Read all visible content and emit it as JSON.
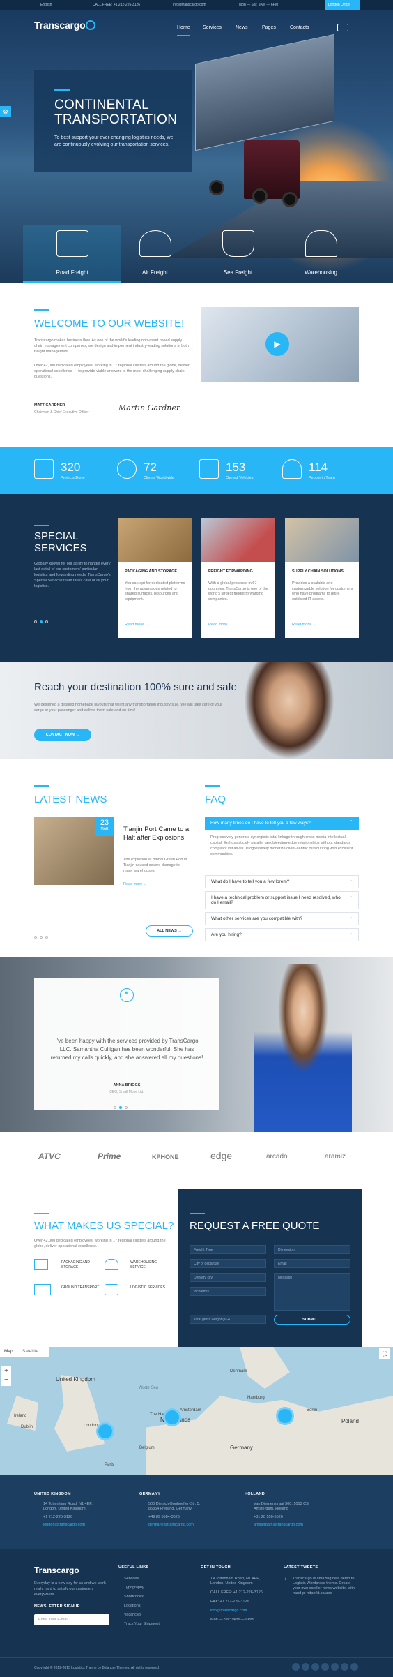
{
  "topbar": {
    "lang": "English",
    "phone": "CALL FREE: +1 212-226-3126",
    "email": "info@transcargo.com",
    "hours": "Mon — Sat: 9AM — 6PM",
    "office": "London Office"
  },
  "brand": {
    "name": "Transcargo"
  },
  "nav": [
    "Home",
    "Services",
    "News",
    "Pages",
    "Contacts"
  ],
  "hero": {
    "title_1": "CONTINENTAL",
    "title_2": "TRANSPORTATION",
    "text": "To best support your ever-changing logistics needs, we are continuously evolving our transportation services."
  },
  "freight": [
    "Road Freight",
    "Air Freight",
    "Sea Freight",
    "Warehousing"
  ],
  "welcome": {
    "title": "WELCOME TO OUR WEBSITE!",
    "p1": "Transcargo makes business flow. As one of the world's leading non-asset based supply chain management companies, we design and implement industry-leading solutions in both freight management.",
    "p2": "Over 42,000 dedicated employees, working in 17 regional clusters around the globe, deliver operational excellence — to provide viable answers to the most challenging supply chain questions.",
    "name": "MATT GARDNER",
    "role": "Chairman & Chief Executive Officer",
    "signature": "Martin Gardner"
  },
  "stats": [
    {
      "n": "320",
      "l": "Projects Done"
    },
    {
      "n": "72",
      "l": "Clients Worldwide"
    },
    {
      "n": "153",
      "l": "Owned Vehicles"
    },
    {
      "n": "114",
      "l": "People in Team"
    }
  ],
  "services": {
    "title_1": "SPECIAL",
    "title_2": "SERVICES",
    "text": "Globally known for our ability to handle every last detail of our customers' particular logistics and forwarding needs, TransCargo's Special Services team takes care of all your logistics.",
    "cards": [
      {
        "t": "PACKAGING AND STORAGE",
        "d": "You can opt for dedicated platforms from the advantages related to shared surfaces, resources and equipment.",
        "r": "Read more →"
      },
      {
        "t": "FREIGHT FORWARDING",
        "d": "With a global presence in 67 countries, TransCargo is one of the world's largest freight forwarding companies.",
        "r": "Read more →"
      },
      {
        "t": "SUPPLY CHAIN SOLUTIONS",
        "d": "Provides a scalable and customizable solution for customers who have programs to retire outdated IT assets.",
        "r": "Read more →"
      }
    ]
  },
  "reach": {
    "title": "Reach your destination 100% sure and safe",
    "text": "We designed a detailed homepage layouts that will fit any transportation industry size. We will take care of your cargo or your passenger and deliver them safe and on time!",
    "button": "CONTACT NOW →"
  },
  "news": {
    "title": "LATEST NEWS",
    "day": "23",
    "month": "MAR",
    "headline": "Tianjin Port Came to a Halt after Explosions",
    "text": "The explosion at Binhai Green Port in Tianjin caused severe damage to many warehouses.",
    "more": "Read more →",
    "all": "ALL NEWS →"
  },
  "faq": {
    "title": "FAQ",
    "active": "How many times do I have to tell you a few ways?",
    "answer": "Progressively generate synergistic total linkage through cross-media intellectual capital. Enthusiastically parallel task bleeding-edge relationships without standards compliant initiatives. Progressively monetize client-centric outsourcing with excellent communities.",
    "items": [
      "What do I have to tell you a few lorem?",
      "I have a technical problem or support issue I need resolved, who do I email?",
      "What other services are you compatible with?",
      "Are you hiring?"
    ]
  },
  "testimonial": {
    "quote": "I've been happy with the services provided by TransCargo LLC. Samantha Culligan has been wonderful! She has returned my calls quickly, and she answered all my questions!",
    "name": "ANNA BRIGGS",
    "role": "CEO, Small Move Ltd."
  },
  "logos": [
    "ATVC",
    "Prime",
    "KPHONE",
    "edge",
    "arcado",
    "aramiz"
  ],
  "why": {
    "title": "WHAT MAKES US SPECIAL?",
    "text": "Over 42,000 dedicated employees, working in 17 regional clusters around the globe, deliver operational excellence.",
    "items": [
      "PACKAGING AND STORAGE",
      "WAREHOUSING SERVICE",
      "GROUND TRANSPORT",
      "LOGISTIC SERVICES"
    ]
  },
  "quote": {
    "title": "REQUEST A FREE QUOTE",
    "fields": [
      "Freight Type",
      "City of departure",
      "Delivery city",
      "Incoterms",
      "Total gross weight (KG)"
    ],
    "fields_r": [
      "Dimension",
      "Email",
      "Message"
    ],
    "submit": "SUBMIT →"
  },
  "map": {
    "tab1": "Map",
    "tab2": "Satellite",
    "labels": [
      "United Kingdom",
      "Ireland",
      "Denmark",
      "Netherlands",
      "Germany",
      "Poland",
      "Belgium",
      "London",
      "Hamburg",
      "Berlin",
      "Amsterdam",
      "Paris",
      "Dublin",
      "North Sea",
      "The Hague"
    ]
  },
  "offices": [
    {
      "c": "UNITED KINGDOM",
      "a": "14 Tottenham Road, N1 4EP, London, United Kingdom",
      "p": "+1 212-226-3126",
      "e": "london@transcargo.com"
    },
    {
      "c": "GERMANY",
      "a": "500 Dietrich-Bonhoeffer-Str. 5, 85354 Freising, Germany",
      "p": "+49 89 5684-3626",
      "e": "germany@transcargo.com"
    },
    {
      "c": "HOLLAND",
      "a": "Van Diemenstraat 300, 1013 CS Amsterdam, Holland",
      "p": "+31 20 556-5526",
      "e": "amsterdam@transcargo.com"
    }
  ],
  "footer": {
    "tagline": "Everyday is a new day for us and we work really hard to satisfy our customers everywhere.",
    "signup": "NEWSLETTER SIGNUP",
    "email_ph": "Enter Your E-mail",
    "useful": "USEFUL LINKS",
    "links": [
      "Services",
      "Typography",
      "Shortcodes",
      "Locations",
      "Vacancies",
      "Track Your Shipment"
    ],
    "touch": "GET IN TOUCH",
    "touch_items": [
      "14 Tottenham Road, N1 4EP, London, United Kingdom",
      "CALL FREE: +1 212-226-3126",
      "FAX: +1 212-226-3126",
      "info@transcargo.com",
      "Mon — Sat: 9AM — 6PM"
    ],
    "tweets": "LATEST TWEETS",
    "tweet": "Transcargo is amazing new demo to Logistic Wordpress theme. Create your own scroller news website, with hand-p: https://t.co/abc",
    "copyright": "Copyright © 2012-2015 Logistics Theme by Bylancer Themes. All rights reserved"
  }
}
